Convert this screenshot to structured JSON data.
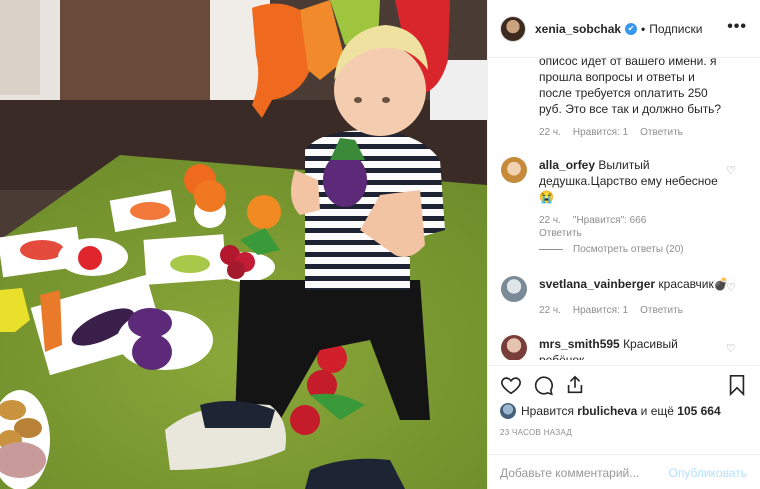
{
  "header": {
    "username": "xenia_sobchak",
    "follow_label": "Подписки",
    "more_label": "•••"
  },
  "comments": {
    "partial": {
      "lines": [
        "описос идет от вашего имени. я",
        "прошла вопросы и ответы и",
        "после требуется оплатить 250",
        "руб. Это все так и должно быть?"
      ],
      "time": "22 ч.",
      "likes": "Нравится: 1",
      "reply": "Ответить"
    },
    "items": [
      {
        "user": "alla_orfey",
        "text_1": "Вылитый",
        "text_2": "дедушка.Царство ему небесное",
        "text_3": "😭",
        "time": "22 ч.",
        "likes": "\"Нравится\": 666",
        "reply": "Ответить",
        "view_replies": "Посмотреть ответы (20)"
      },
      {
        "user": "svetlana_vainberger",
        "text": "красавчик💣",
        "time": "22 ч.",
        "likes": "Нравится: 1",
        "reply": "Ответить"
      },
      {
        "user": "mrs_smith595",
        "text_1": "Красивый",
        "text_2": "ребёнок"
      }
    ]
  },
  "likes": {
    "prefix": "Нравится",
    "user": "rbulicheva",
    "suffix": "и ещё",
    "count": "105 664"
  },
  "timestamp": "23 ЧАСОВ НАЗАД",
  "add_comment": {
    "placeholder": "Добавьте комментарий...",
    "publish": "Опубликовать"
  },
  "colors": {
    "verified": "#3897f0",
    "publish_disabled": "#b2dffc",
    "meta_text": "#8e8e8e",
    "border": "#efefef"
  },
  "icons": [
    "heart-icon",
    "comment-icon",
    "share-icon",
    "bookmark-icon",
    "verified-icon",
    "more-icon"
  ]
}
